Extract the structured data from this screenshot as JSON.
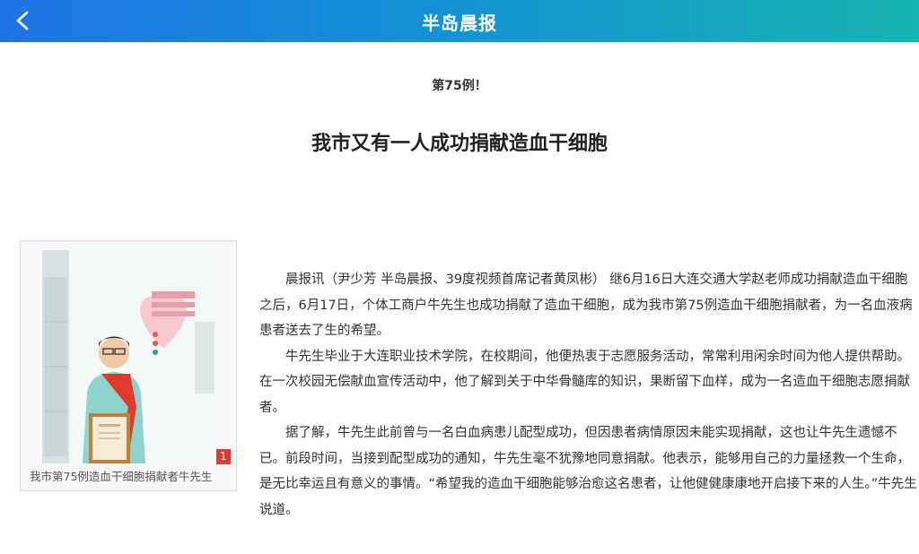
{
  "header": {
    "title": "半岛晨报",
    "back_icon": "chevron-left-icon",
    "gradient_start": "#1f73e6",
    "gradient_end": "#16b3b0"
  },
  "article": {
    "kicker": "第75例！",
    "headline": "我市又有一人成功捐献造血干细胞",
    "paragraphs": [
      "晨报讯（尹少芳 半岛晨报、39度视频首席记者黄凤彬） 继6月16日大连交通大学赵老师成功捐献造血干细胞之后，6月17日，个体工商户牛先生也成功捐献了造血干细胞，成为我市第75例造血干细胞捐献者，为一名血液病患者送去了生的希望。",
      "牛先生毕业于大连职业技术学院，在校期间，他便热衷于志愿服务活动，常常利用闲余时间为他人提供帮助。在一次校园无偿献血宣传活动中，他了解到关于中华骨髓库的知识，果断留下血样，成为一名造血干细胞志愿捐献者。",
      "据了解，牛先生此前曾与一名白血病患儿配型成功，但因患者病情原因未能实现捐献，这也让牛先生遗憾不已。前段时间，当接到配型成功的通知，牛先生毫不犹豫地同意捐献。他表示，能够用自己的力量拯救一个生命，是无比幸运且有意义的事情。“希望我的造血干细胞能够治愈这名患者，让他健健康康地开启接下来的人生。”牛先生说道。"
    ]
  },
  "photo": {
    "index": "1",
    "caption": "我市第75例造血干细胞捐献者牛先生"
  }
}
